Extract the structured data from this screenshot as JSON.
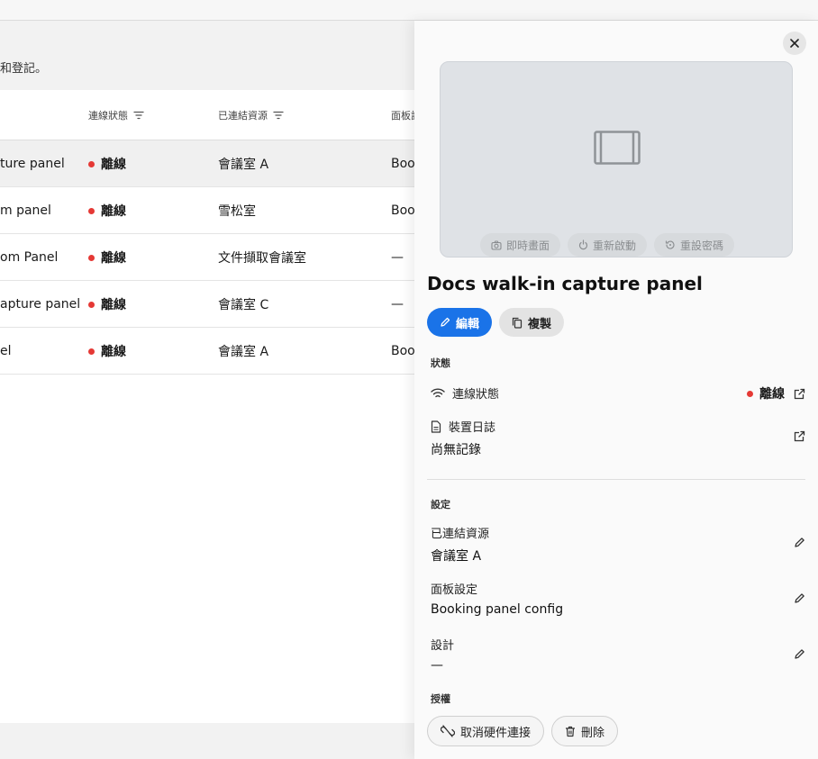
{
  "page": {
    "subtitle": "和登記。"
  },
  "table": {
    "headers": {
      "status": "連線狀態",
      "resource": "已連結資源",
      "config": "面板設"
    },
    "rows": [
      {
        "name": "ture panel",
        "status": "離線",
        "resource": "會議室 A",
        "config": "Boo"
      },
      {
        "name": "m panel",
        "status": "離線",
        "resource": "雪松室",
        "config": "Boo"
      },
      {
        "name": "om Panel",
        "status": "離線",
        "resource": "文件擷取會議室",
        "config": "—"
      },
      {
        "name": "apture panel",
        "status": "離線",
        "resource": "會議室 C",
        "config": "—"
      },
      {
        "name": "el",
        "status": "離線",
        "resource": "會議室 A",
        "config": "Boo"
      }
    ]
  },
  "panel": {
    "close_icon": "close-icon",
    "preview_actions": {
      "live": "即時畫面",
      "restart": "重新啟動",
      "reset_password": "重設密碼"
    },
    "title": "Docs walk-in capture panel",
    "edit_label": "編輯",
    "copy_label": "複製",
    "status_section": "狀態",
    "connection": {
      "label": "連線狀態",
      "value": "離線"
    },
    "device_log": {
      "label": "裝置日誌",
      "value": "尚無記錄"
    },
    "settings_section": "設定",
    "linked_resource": {
      "label": "已連結資源",
      "value": "會議室 A"
    },
    "panel_config": {
      "label": "面板設定",
      "value": "Booking panel config"
    },
    "design": {
      "label": "設計",
      "value": "—"
    },
    "license_section": "授權",
    "unpair_label": "取消硬件連接",
    "delete_label": "刪除"
  },
  "colors": {
    "primary": "#1a73e8",
    "offline": "#e53935"
  }
}
